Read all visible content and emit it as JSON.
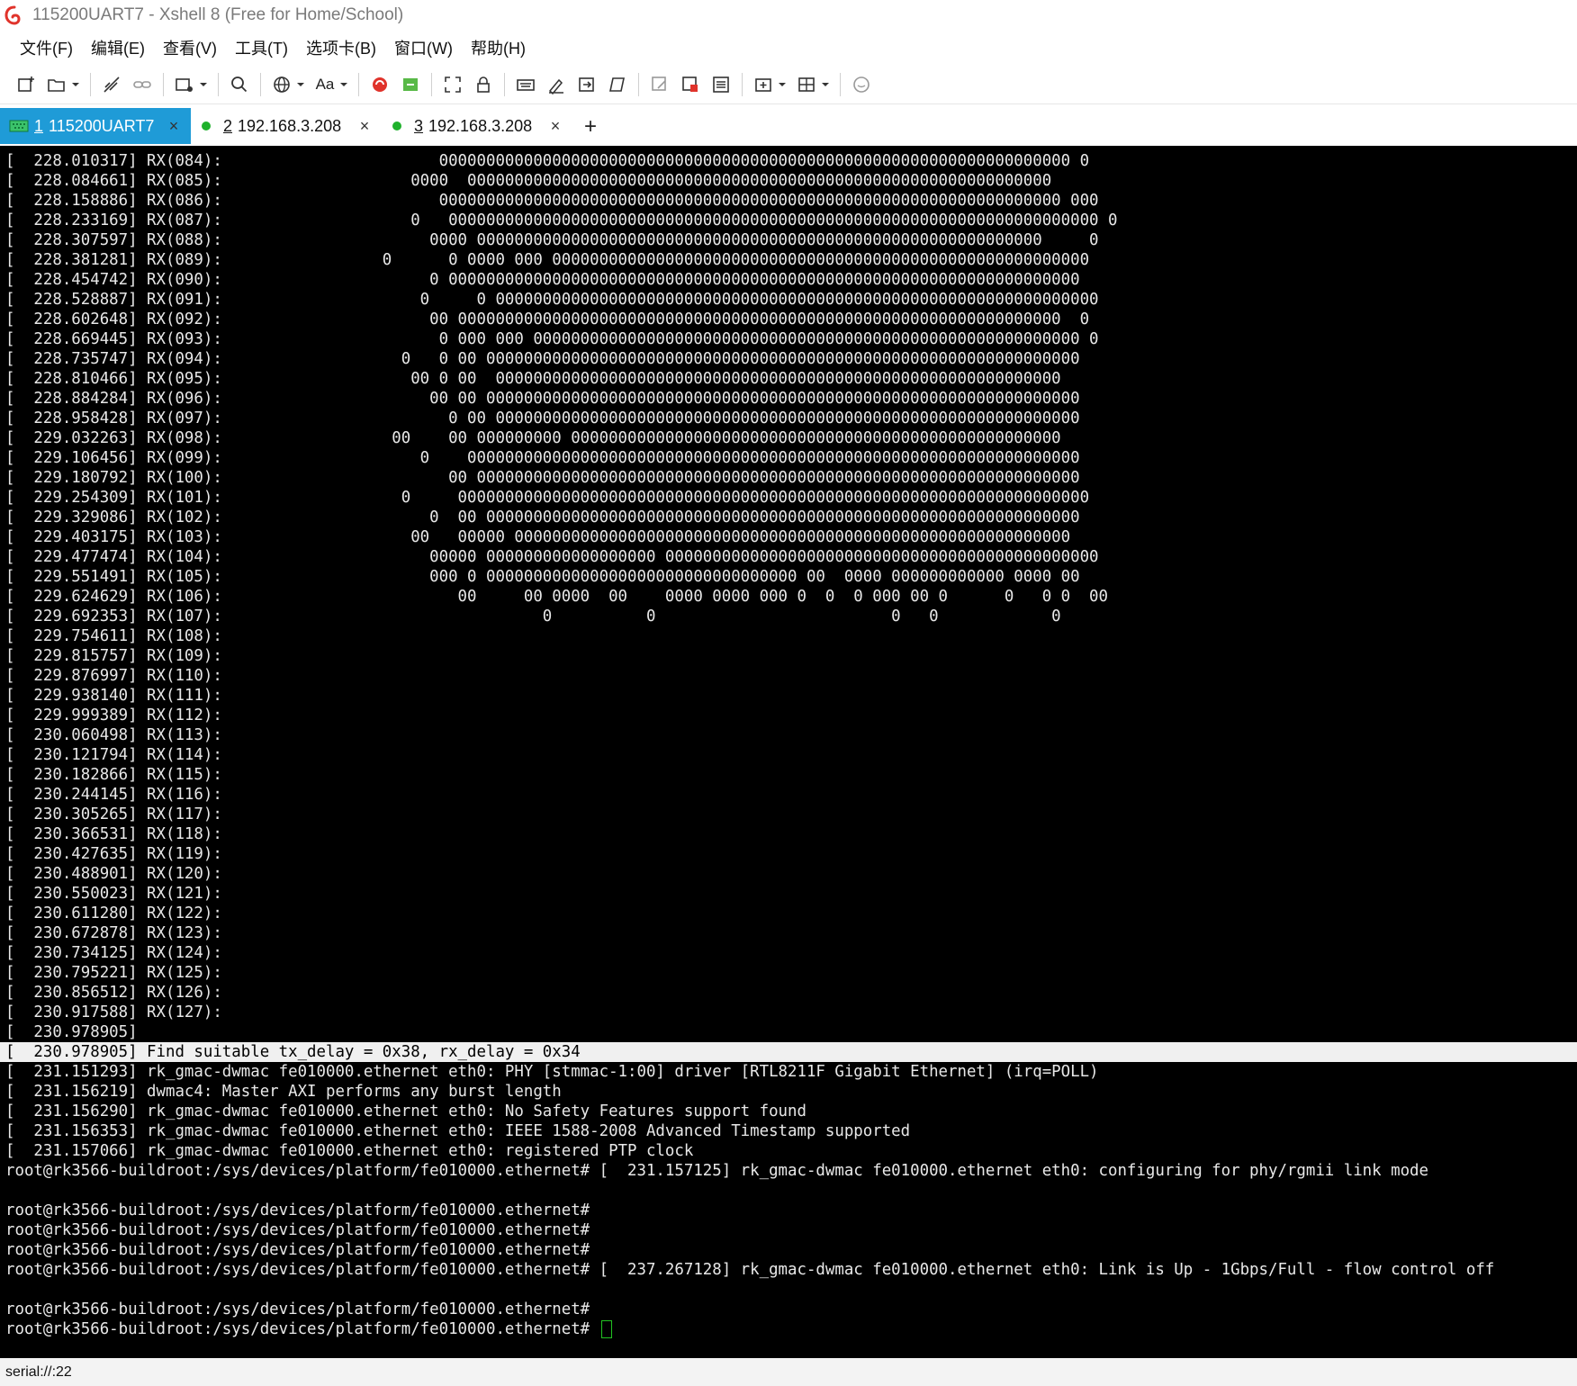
{
  "window": {
    "title": "115200UART7 - Xshell 8 (Free for Home/School)"
  },
  "menu": [
    "文件(F)",
    "编辑(E)",
    "查看(V)",
    "工具(T)",
    "选项卡(B)",
    "窗口(W)",
    "帮助(H)"
  ],
  "toolbar": {
    "font_button_label": "Aa"
  },
  "tabs": [
    {
      "num": "1",
      "label": "115200UART7",
      "active": true
    },
    {
      "num": "2",
      "label": "192.168.3.208",
      "active": false
    },
    {
      "num": "3",
      "label": "192.168.3.208",
      "active": false
    }
  ],
  "tab_close_glyph": "×",
  "tab_add_glyph": "+",
  "terminal": {
    "lines": [
      "[  228.010317] RX(084):                       0000000000000000000000000000000000000000000000000000000000000000000 0",
      "[  228.084661] RX(085):                    0000  00000000000000000000000000000000000000000000000000000000000000",
      "[  228.158886] RX(086):                       000000000000000000000000000000000000000000000000000000000000000000 000",
      "[  228.233169] RX(087):                    0   000000000000000000000000000000000000000000000000000000000000000000000 0",
      "[  228.307597] RX(088):                      0000 000000000000000000000000000000000000000000000000000000000000     0",
      "[  228.381281] RX(089):                 0      0 0000 000 000000000000000000000000000000000000000000000000000000000",
      "[  228.454742] RX(090):                      0 0000000000000000000000000000000000000000000000000000000000000000000",
      "[  228.528887] RX(091):                     0     0 0000000000000000000000000000000000000000000000000000000000000000",
      "[  228.602648] RX(092):                      00 0000000000000000000000000000000000000000000000000000000000000000  0",
      "[  228.669445] RX(093):                       0 000 000 0000000000000000000000000000000000000000000000000000000000 0",
      "[  228.735747] RX(094):                   0   0 00 000000000000000000000000000000000000000000000000000000000000000",
      "[  228.810466] RX(095):                    00 0 00  000000000000000000000000000000000000000000000000000000000000",
      "[  228.884284] RX(096):                      00 00 000000000000000000000000000000000000000000000000000000000000000",
      "[  228.958428] RX(097):                        0 00 00000000000000000000000000000000000000000000000000000000000000",
      "[  229.032263] RX(098):                  00    00 000000000 0000000000000000000000000000000000000000000000000000",
      "[  229.106456] RX(099):                     0    00000000000000000000000000000000000000000000000000000000000000000",
      "[  229.180792] RX(100):                        00 0000000000000000000000000000000000000000000000000000000000000000",
      "[  229.254309] RX(101):                   0     0000000000000000000000000000000000000000000000000000000000000000000",
      "[  229.329086] RX(102):                      0  00 000000000000000000000000000000000000000000000000000000000000000",
      "[  229.403175] RX(103):                    00   00000 00000000000000000000000000000000000000000000000000000000000",
      "[  229.477474] RX(104):                      00000 000000000000000000 0000000000000000000000000000000000000000000000",
      "[  229.551491] RX(105):                      000 0 000000000000000000000000000000000 00  0000 000000000000 0000 00",
      "[  229.624629] RX(106):                         00     00 0000  00    0000 0000 000 0  0  0 000 00 0      0   0 0  00",
      "[  229.692353] RX(107):                                  0          0                         0   0            0",
      "[  229.754611] RX(108):",
      "[  229.815757] RX(109):",
      "[  229.876997] RX(110):",
      "[  229.938140] RX(111):",
      "[  229.999389] RX(112):",
      "[  230.060498] RX(113):",
      "[  230.121794] RX(114):",
      "[  230.182866] RX(115):",
      "[  230.244145] RX(116):",
      "[  230.305265] RX(117):",
      "[  230.366531] RX(118):",
      "[  230.427635] RX(119):",
      "[  230.488901] RX(120):",
      "[  230.550023] RX(121):",
      "[  230.611280] RX(122):",
      "[  230.672878] RX(123):",
      "[  230.734125] RX(124):",
      "[  230.795221] RX(125):",
      "[  230.856512] RX(126):",
      "[  230.917588] RX(127):",
      "[  230.978905]",
      "[  230.978905] Find suitable tx_delay = 0x38, rx_delay = 0x34",
      "[  231.151293] rk_gmac-dwmac fe010000.ethernet eth0: PHY [stmmac-1:00] driver [RTL8211F Gigabit Ethernet] (irq=POLL)",
      "[  231.156219] dwmac4: Master AXI performs any burst length",
      "[  231.156290] rk_gmac-dwmac fe010000.ethernet eth0: No Safety Features support found",
      "[  231.156353] rk_gmac-dwmac fe010000.ethernet eth0: IEEE 1588-2008 Advanced Timestamp supported",
      "[  231.157066] rk_gmac-dwmac fe010000.ethernet eth0: registered PTP clock",
      "root@rk3566-buildroot:/sys/devices/platform/fe010000.ethernet# [  231.157125] rk_gmac-dwmac fe010000.ethernet eth0: configuring for phy/rgmii link mode",
      "",
      "root@rk3566-buildroot:/sys/devices/platform/fe010000.ethernet#",
      "root@rk3566-buildroot:/sys/devices/platform/fe010000.ethernet#",
      "root@rk3566-buildroot:/sys/devices/platform/fe010000.ethernet#",
      "root@rk3566-buildroot:/sys/devices/platform/fe010000.ethernet# [  237.267128] rk_gmac-dwmac fe010000.ethernet eth0: Link is Up - 1Gbps/Full - flow control off",
      "",
      "root@rk3566-buildroot:/sys/devices/platform/fe010000.ethernet#",
      "root@rk3566-buildroot:/sys/devices/platform/fe010000.ethernet# "
    ],
    "highlighted_line_index": 45,
    "cursor_line_index": 59
  },
  "statusbar": {
    "text": "serial://:22"
  },
  "colors": {
    "terminal_bg": "#000000",
    "terminal_fg": "#e8e8e8",
    "active_tab": "#1f9bd7",
    "connected_dot": "#1fb12c",
    "cursor": "#22c322",
    "highlight_bg": "#f0f0f0"
  },
  "icons": [
    "new-session-icon",
    "open-folder-icon",
    "disconnect-icon",
    "link-icon",
    "new-window-icon",
    "search-icon",
    "globe-icon",
    "font-icon",
    "xshell-logo-icon",
    "xftp-icon",
    "fullscreen-icon",
    "lock-icon",
    "keyboard-icon",
    "script-icon",
    "transfer-icon",
    "log-icon",
    "compose-icon",
    "highlight-icon",
    "notes-icon",
    "add-tab-icon",
    "layout-icon",
    "chat-icon"
  ]
}
